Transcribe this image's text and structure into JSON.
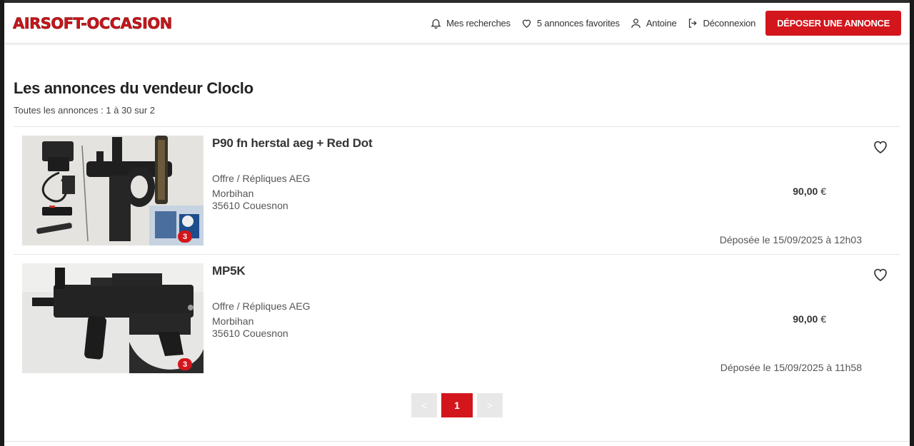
{
  "header": {
    "logo_text": "AIRSOFT-OCCASION",
    "nav": {
      "searches": "Mes recherches",
      "favorites": "5 annonces favorites",
      "user": "Antoine",
      "logout": "Déconnexion"
    },
    "cta": "DÉPOSER UNE ANNONCE"
  },
  "main": {
    "title": "Les annonces du vendeur Cloclo",
    "count": "Toutes les annonces : 1 à 30 sur 2"
  },
  "listings": [
    {
      "title": "P90 fn herstal aeg + Red Dot",
      "category": "Offre / Répliques AEG",
      "region": "Morbihan",
      "city": "35610 Couesnon",
      "price": "90,00",
      "currency": "€",
      "date": "Déposée le 15/09/2025 à 12h03",
      "photos": "3"
    },
    {
      "title": "MP5K",
      "category": "Offre / Répliques AEG",
      "region": "Morbihan",
      "city": "35610 Couesnon",
      "price": "90,00",
      "currency": "€",
      "date": "Déposée le 15/09/2025 à 11h58",
      "photos": "3"
    }
  ],
  "pagination": {
    "prev": "<",
    "current": "1",
    "next": ">"
  },
  "colors": {
    "accent": "#d3161c",
    "text": "#333333"
  }
}
